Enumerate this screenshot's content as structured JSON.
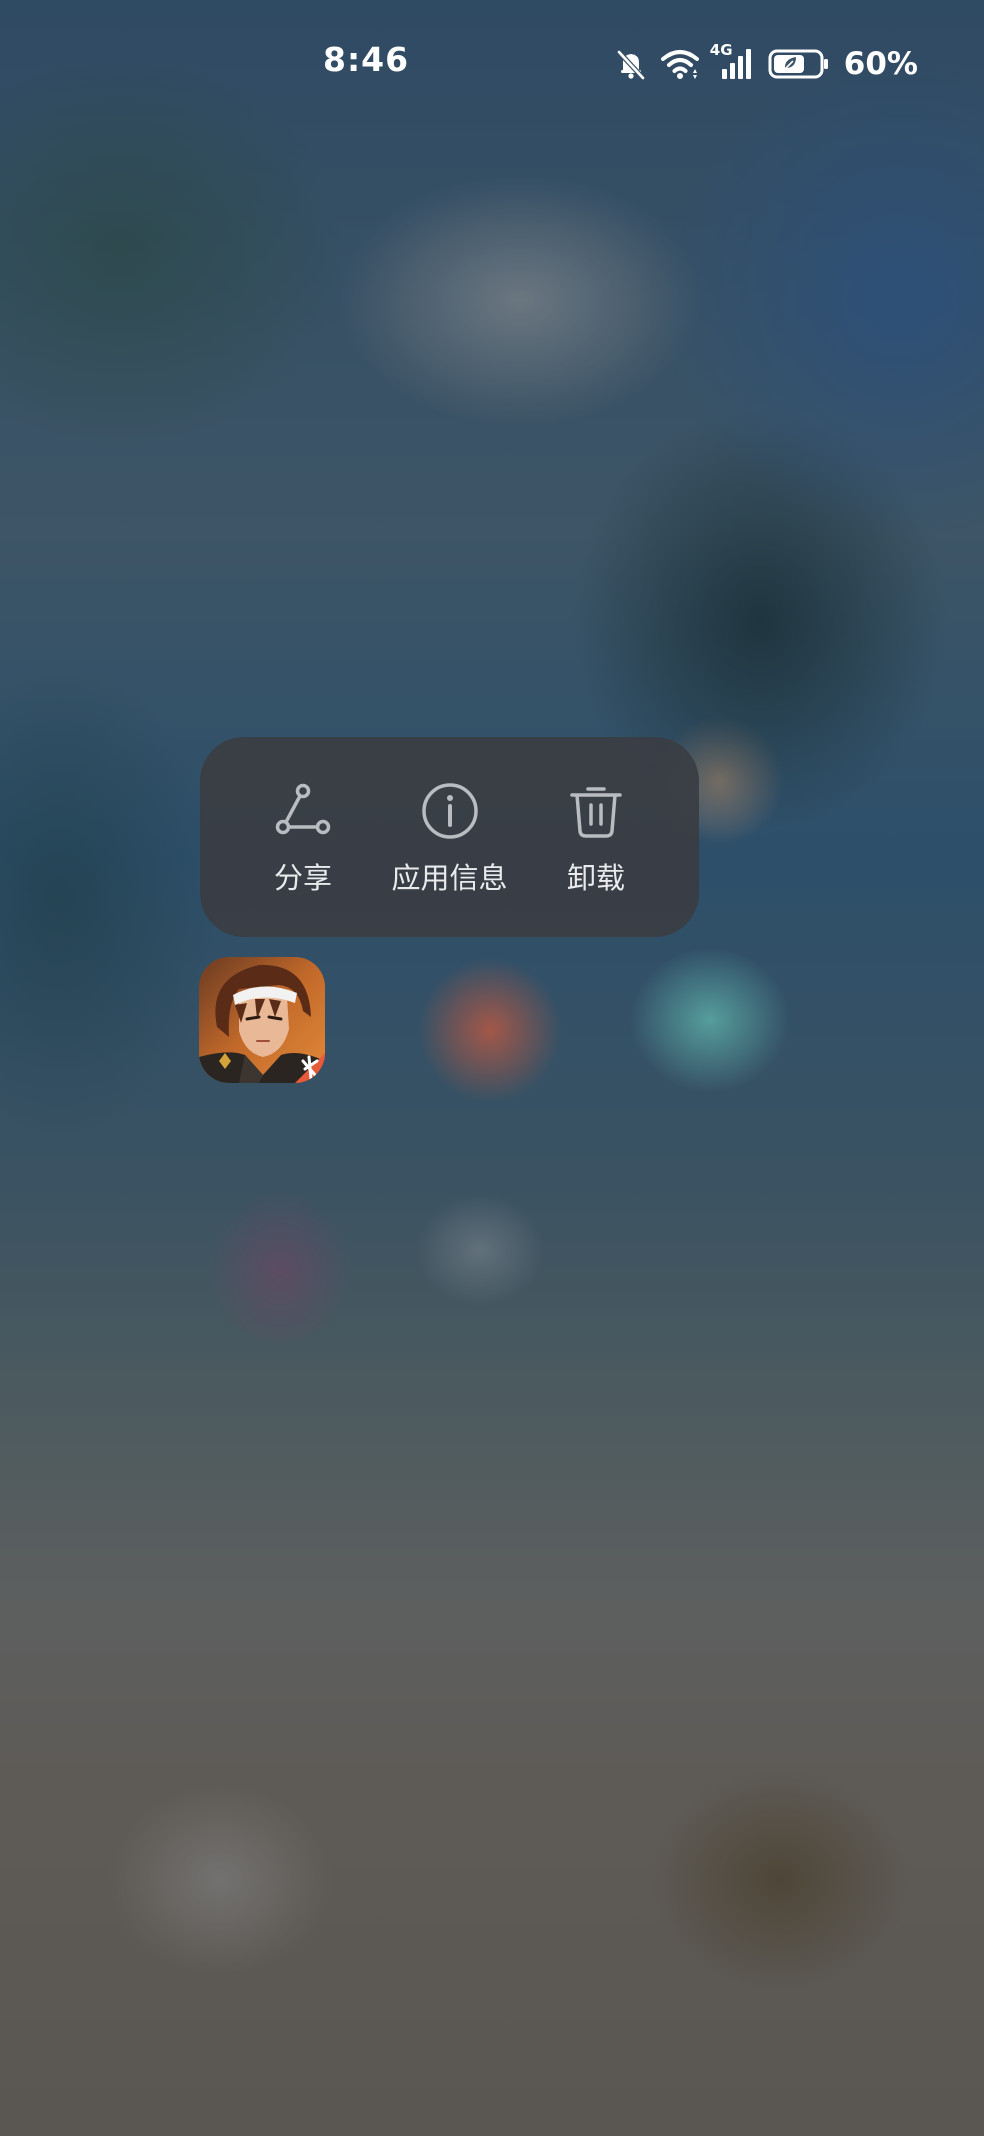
{
  "status_bar": {
    "time": "8:46",
    "network": "4G",
    "battery": "60%",
    "icons": [
      "bell-muted-icon",
      "wifi-icon",
      "signal-4g-icon",
      "battery-saver-icon"
    ]
  },
  "context_menu": {
    "items": [
      {
        "label": "分享",
        "icon": "share-icon"
      },
      {
        "label": "应用信息",
        "icon": "info-icon"
      },
      {
        "label": "卸载",
        "icon": "trash-icon"
      }
    ]
  },
  "app": {
    "icon": "game-character-app-icon"
  },
  "colors": {
    "menu_bg": "#3a3e44",
    "menu_text": "#e9eaec",
    "icon_stroke": "#b9bcc1",
    "status_text": "#ffffff"
  }
}
